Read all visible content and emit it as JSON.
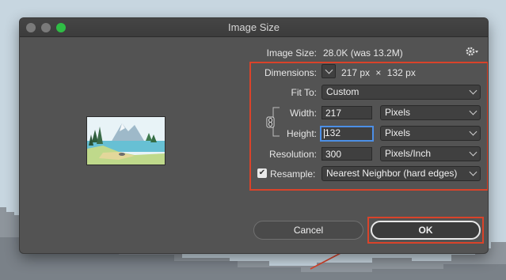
{
  "window": {
    "title": "Image Size"
  },
  "image_size": {
    "label": "Image Size:",
    "value": "28.0K (was 13.2M)"
  },
  "dimensions": {
    "label": "Dimensions:",
    "width": "217",
    "unit": "px",
    "times": "×",
    "height": "132",
    "unit2": "px"
  },
  "fit_to": {
    "label": "Fit To:",
    "value": "Custom"
  },
  "width": {
    "label": "Width:",
    "value": "217",
    "unit": "Pixels"
  },
  "height": {
    "label": "Height:",
    "value": "132",
    "unit": "Pixels"
  },
  "resolution": {
    "label": "Resolution:",
    "value": "300",
    "unit": "Pixels/Inch"
  },
  "resample": {
    "label": "Resample:",
    "checked": true,
    "method": "Nearest Neighbor (hard edges)"
  },
  "buttons": {
    "cancel": "Cancel",
    "ok": "OK"
  },
  "icons": {
    "settings": "gear-icon",
    "link": "chain-link-icon",
    "dimensions_toggle": "chevron-down-icon",
    "checkbox": "checkmark-icon"
  },
  "colors": {
    "highlight": "#d9432a",
    "focus": "#4c8fe6",
    "window_bg": "#535353",
    "zoom_button": "#2fbd45"
  }
}
